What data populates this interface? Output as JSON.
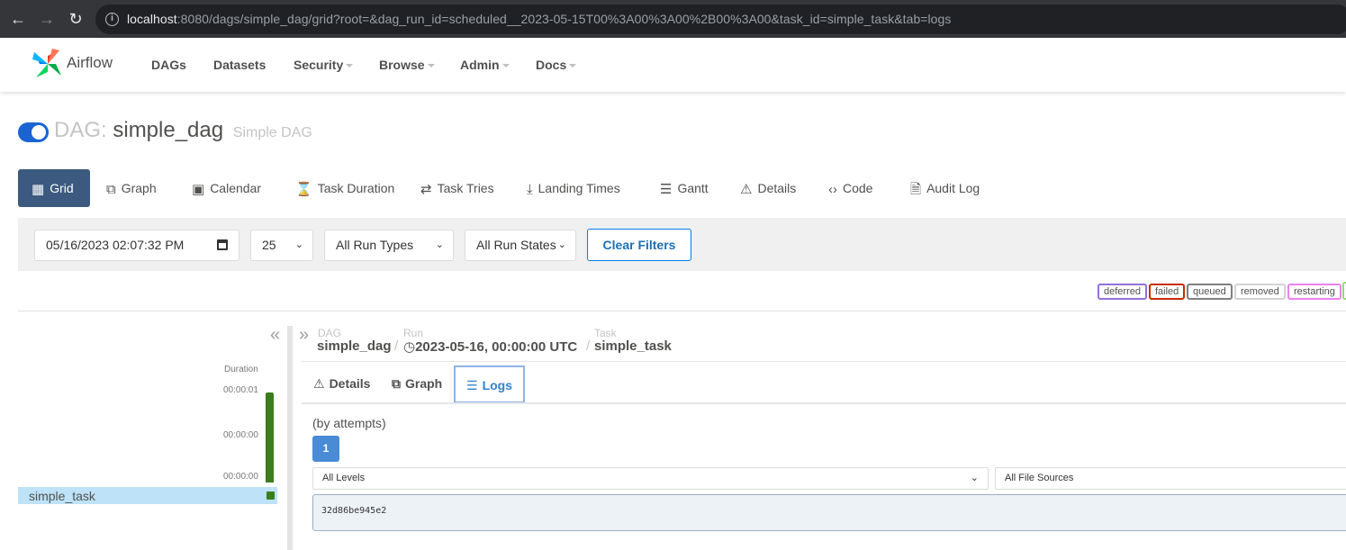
{
  "browser": {
    "url_host": "localhost",
    "url_rest": ":8080/dags/simple_dag/grid?root=&dag_run_id=scheduled__2023-05-15T00%3A00%3A00%2B00%3A00&task_id=simple_task&tab=logs"
  },
  "navbar": {
    "brand": "Airflow",
    "items": [
      "DAGs",
      "Datasets",
      "Security",
      "Browse",
      "Admin",
      "Docs"
    ]
  },
  "dag": {
    "label": "DAG:",
    "name": "simple_dag",
    "description": "Simple DAG",
    "paused": false
  },
  "views": [
    "Grid",
    "Graph",
    "Calendar",
    "Task Duration",
    "Task Tries",
    "Landing Times",
    "Gantt",
    "Details",
    "Code",
    "Audit Log"
  ],
  "filters": {
    "datetime": "05/16/2023  02:07:32  PM",
    "num_runs": "25",
    "run_type": "All Run Types",
    "run_state": "All Run States",
    "clear_label": "Clear Filters"
  },
  "legend": [
    {
      "label": "deferred",
      "color": "#9370db"
    },
    {
      "label": "failed",
      "color": "#c72c00"
    },
    {
      "label": "queued",
      "color": "#808080"
    },
    {
      "label": "removed",
      "color": "#d3d3d3"
    },
    {
      "label": "restarting",
      "color": "#ee82ee"
    }
  ],
  "grid": {
    "duration_label": "Duration",
    "duration_ticks": [
      "00:00:01",
      "00:00:00",
      "00:00:00"
    ],
    "task_name": "simple_task",
    "run_state_color": "#3b7d1d"
  },
  "breadcrumb": {
    "dag_small": "DAG",
    "dag_value": "simple_dag",
    "run_small": "Run",
    "run_value": "2023-05-16, 00:00:00 UTC",
    "task_small": "Task",
    "task_value": "simple_task"
  },
  "task_tabs": [
    "Details",
    "Graph",
    "Logs"
  ],
  "logs": {
    "attempts_label": "(by attempts)",
    "attempt_number": "1",
    "level_select": "All Levels",
    "source_select": "All File Sources",
    "log_text": "32d86be945e2"
  },
  "icons": {
    "back": "arrow-left-icon",
    "forward": "arrow-right-icon",
    "reload": "reload-icon",
    "info": "info-icon"
  }
}
